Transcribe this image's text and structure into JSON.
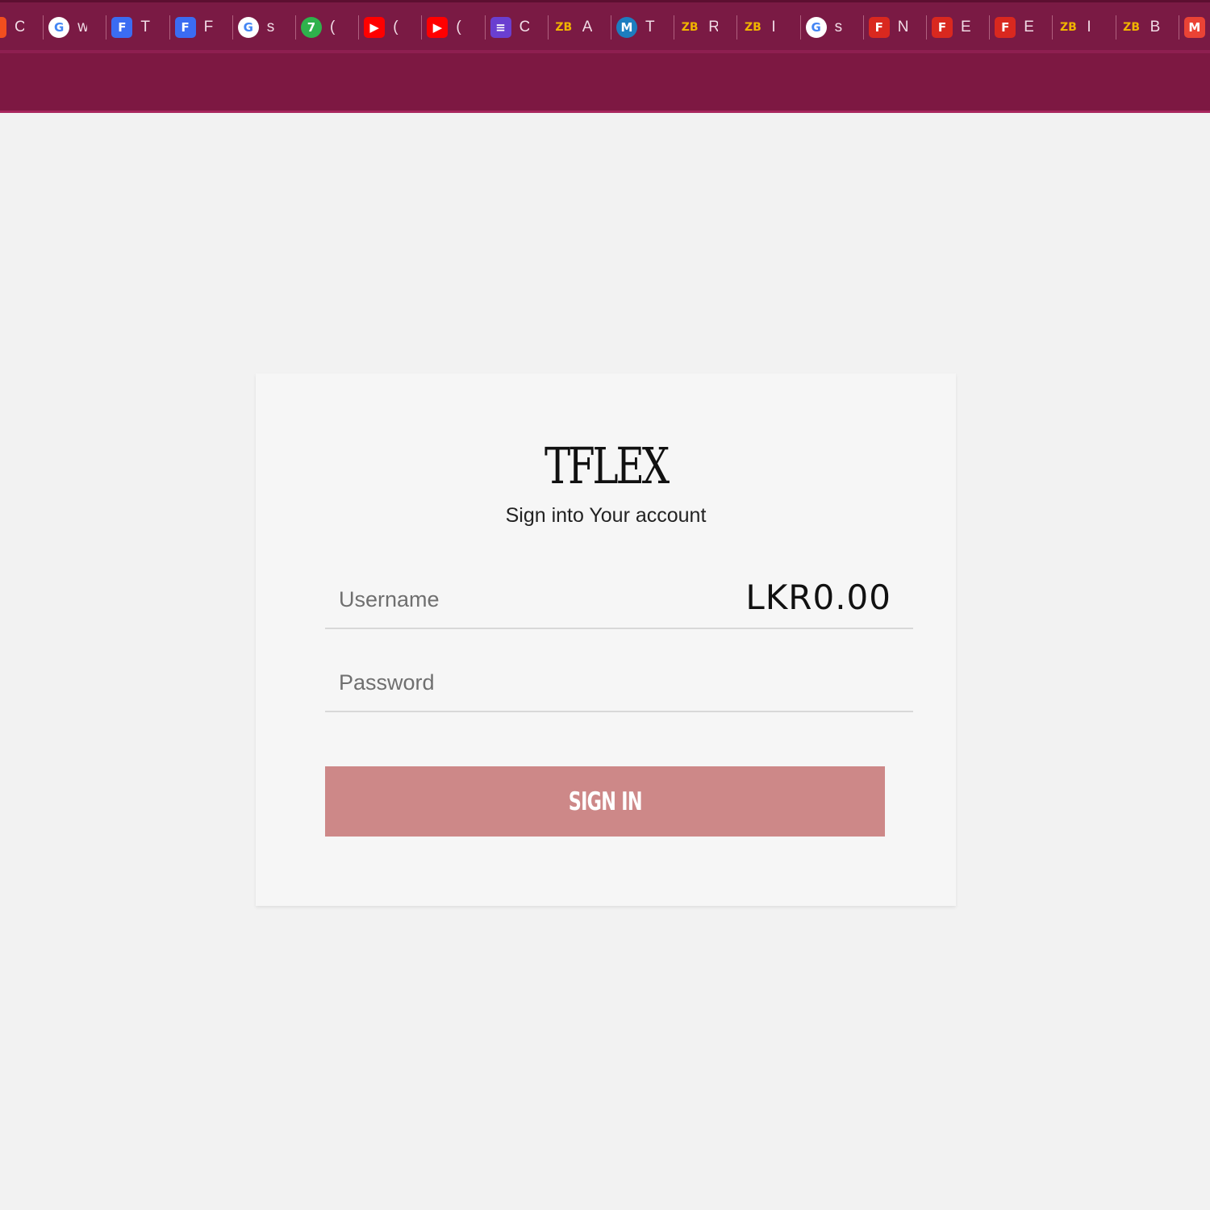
{
  "browser": {
    "tabs": [
      {
        "icon": "figma-icon",
        "title": "C",
        "color": "#f24e1e",
        "glyph": "F"
      },
      {
        "icon": "google-icon",
        "title": "w",
        "color": "#ffffff",
        "glyph": "G"
      },
      {
        "icon": "forms-icon",
        "title": "T",
        "color": "#3b6cf2",
        "glyph": "F"
      },
      {
        "icon": "forms-icon",
        "title": "F",
        "color": "#3b6cf2",
        "glyph": "F"
      },
      {
        "icon": "google-icon",
        "title": "s",
        "color": "#ffffff",
        "glyph": "G"
      },
      {
        "icon": "whatsapp-icon",
        "title": "(",
        "color": "#2fb24c",
        "glyph": "7"
      },
      {
        "icon": "youtube-icon",
        "title": "(",
        "color": "#ff0000",
        "glyph": "▶"
      },
      {
        "icon": "youtube-icon",
        "title": "(",
        "color": "#ff0000",
        "glyph": "▶"
      },
      {
        "icon": "list-icon",
        "title": "C",
        "color": "#6a3fd0",
        "glyph": "≡"
      },
      {
        "icon": "zb-icon",
        "title": "A",
        "color": "#7a1a44",
        "glyph": "ZB"
      },
      {
        "icon": "meta-icon",
        "title": "T",
        "color": "#1d7dbf",
        "glyph": "M"
      },
      {
        "icon": "zb-icon",
        "title": "R",
        "color": "#7a1a44",
        "glyph": "ZB"
      },
      {
        "icon": "zb-icon",
        "title": "I",
        "color": "#7a1a44",
        "glyph": "ZB"
      },
      {
        "icon": "google-icon",
        "title": "s",
        "color": "#ffffff",
        "glyph": "G"
      },
      {
        "icon": "flex-icon",
        "title": "N",
        "color": "#d9281f",
        "glyph": "F"
      },
      {
        "icon": "flash-icon",
        "title": "E",
        "color": "#d9281f",
        "glyph": "F"
      },
      {
        "icon": "flex-icon",
        "title": "E",
        "color": "#d9281f",
        "glyph": "F"
      },
      {
        "icon": "zb-icon",
        "title": "I",
        "color": "#7a1a44",
        "glyph": "ZB"
      },
      {
        "icon": "zb-icon",
        "title": "B",
        "color": "#7a1a44",
        "glyph": "ZB"
      },
      {
        "icon": "gmail-icon",
        "title": "",
        "color": "#ea4335",
        "glyph": "M"
      }
    ]
  },
  "login": {
    "logo": "TFLEX",
    "subtitle": "Sign into Your account",
    "username_placeholder": "Username",
    "password_placeholder": "Password",
    "balance": "LKR0.00",
    "signin_label": "SIGN IN"
  },
  "colors": {
    "header": "#7a1a44",
    "button": "#cd8888",
    "background": "#f2f2f2"
  }
}
